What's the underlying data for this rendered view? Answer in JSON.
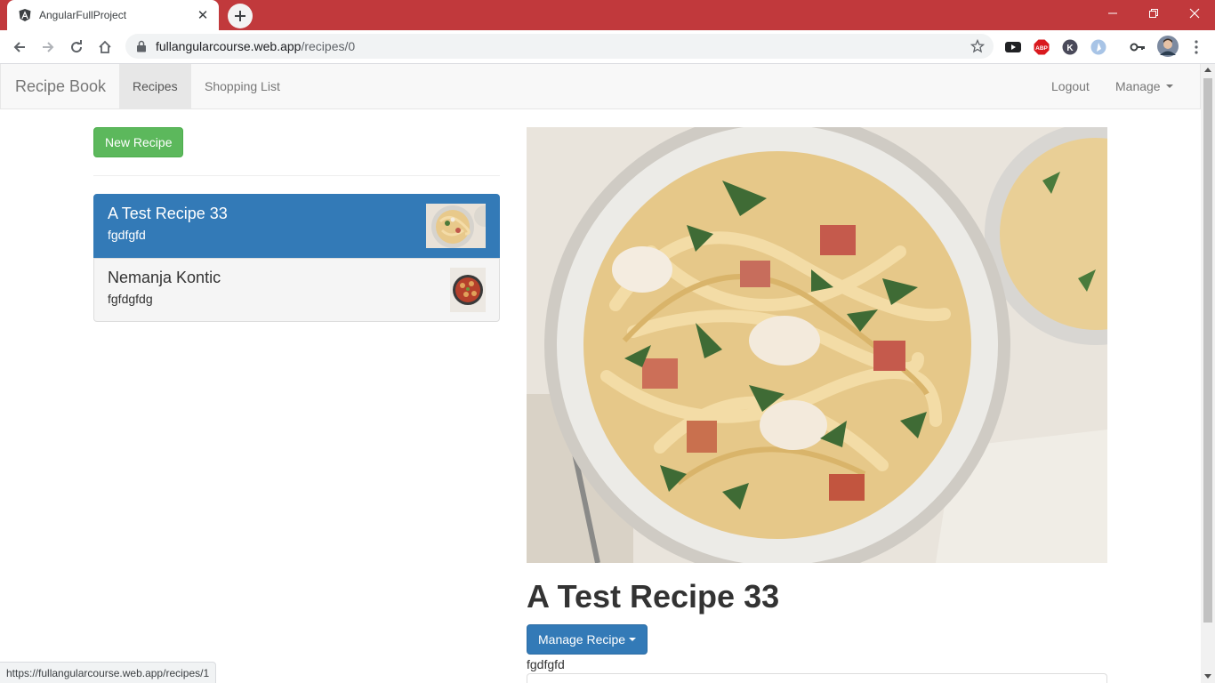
{
  "browser": {
    "tab_title": "AngularFullProject",
    "url_host": "fullangularcourse.web.app",
    "url_path": "/recipes/0",
    "status_url": "https://fullangularcourse.web.app/recipes/1",
    "accent_color": "#c1393c"
  },
  "navbar": {
    "brand": "Recipe Book",
    "links": [
      "Recipes",
      "Shopping List"
    ],
    "right_links": [
      "Logout",
      "Manage"
    ]
  },
  "sidebar": {
    "new_button": "New Recipe",
    "recipes": [
      {
        "name": "A Test Recipe 33",
        "description": "fgdfgfd",
        "image": "pasta-thumbnail",
        "selected": true
      },
      {
        "name": "Nemanja Kontic",
        "description": "fgfdgfdg",
        "image": "skillet-thumbnail",
        "selected": false
      }
    ]
  },
  "detail": {
    "image": "creamy-fettuccine-photo",
    "title": "A Test Recipe 33",
    "manage_button": "Manage Recipe",
    "description": "fgdfgfd"
  },
  "colors": {
    "primary": "#337ab7",
    "success": "#5cb85c"
  }
}
